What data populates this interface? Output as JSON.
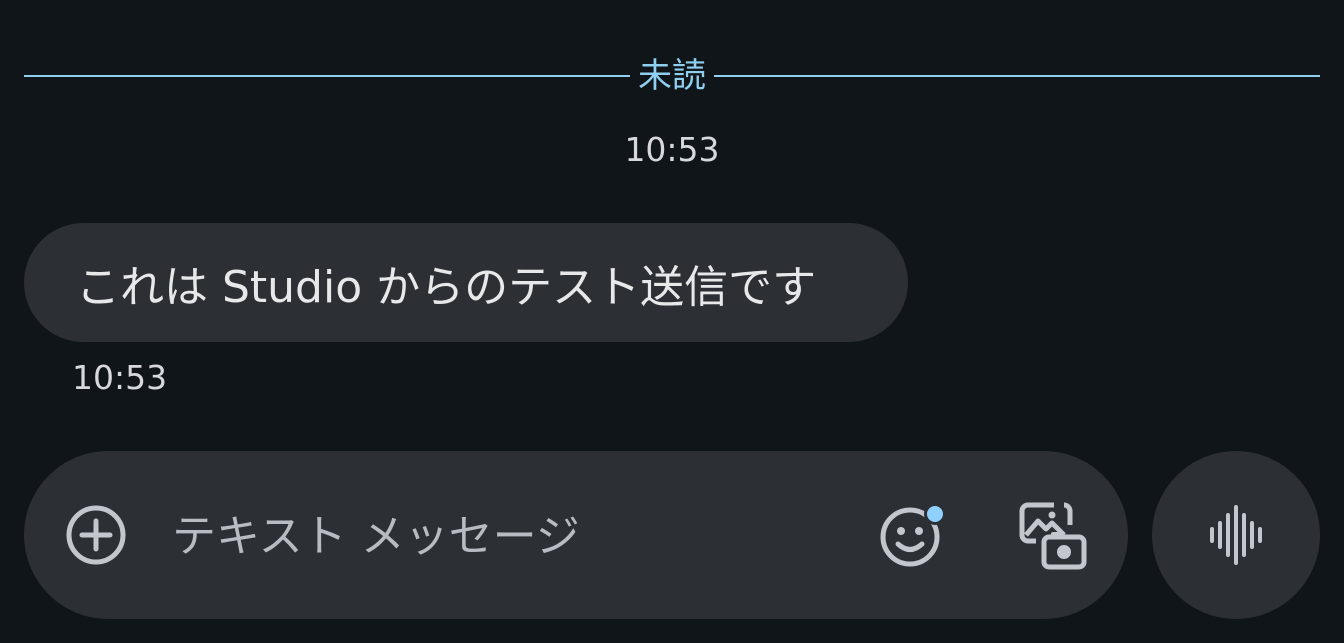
{
  "unread_divider": {
    "label": "未読"
  },
  "thread": {
    "timestamp_header": "10:53",
    "messages": [
      {
        "text": "これは Studio からのテスト送信です",
        "time": "10:53",
        "direction": "incoming"
      }
    ]
  },
  "composer": {
    "placeholder": "テキスト メッセージ",
    "value": "",
    "add_icon": "add-circle-icon",
    "emoji_icon": "emoji-smile-icon",
    "emoji_badge": true,
    "gallery_icon": "gallery-icon",
    "voice_icon": "voice-waveform-icon"
  },
  "colors": {
    "background": "#10151a",
    "surface": "#2c3034",
    "accent": "#8fcff0",
    "text": "#e7e8ea"
  }
}
